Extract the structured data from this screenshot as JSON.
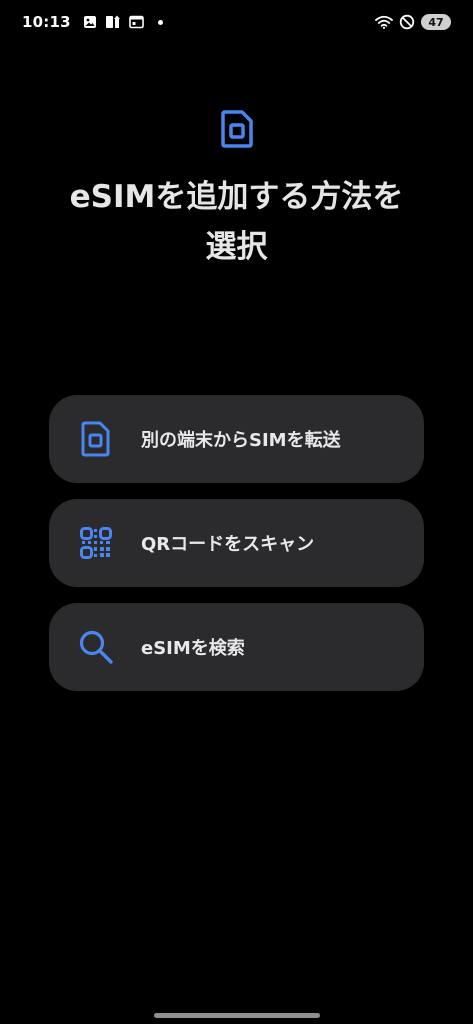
{
  "status_bar": {
    "time": "10:13",
    "battery": "47",
    "icons": [
      "image-icon",
      "phone-upload-icon",
      "calendar-icon",
      "wifi-icon",
      "do-not-disturb-icon"
    ]
  },
  "colors": {
    "background": "#000000",
    "card": "#2b2b2e",
    "accent": "#4a86f0",
    "text": "#e8e8ea"
  },
  "main": {
    "icon": "sim-card-icon",
    "title_line1": "eSIMを追加する方法を",
    "title_line2": "選択",
    "options": [
      {
        "icon": "sim-card-icon",
        "label": "別の端末からSIMを転送"
      },
      {
        "icon": "qr-code-icon",
        "label": "QRコードをスキャン"
      },
      {
        "icon": "search-icon",
        "label": "eSIMを検索"
      }
    ]
  }
}
